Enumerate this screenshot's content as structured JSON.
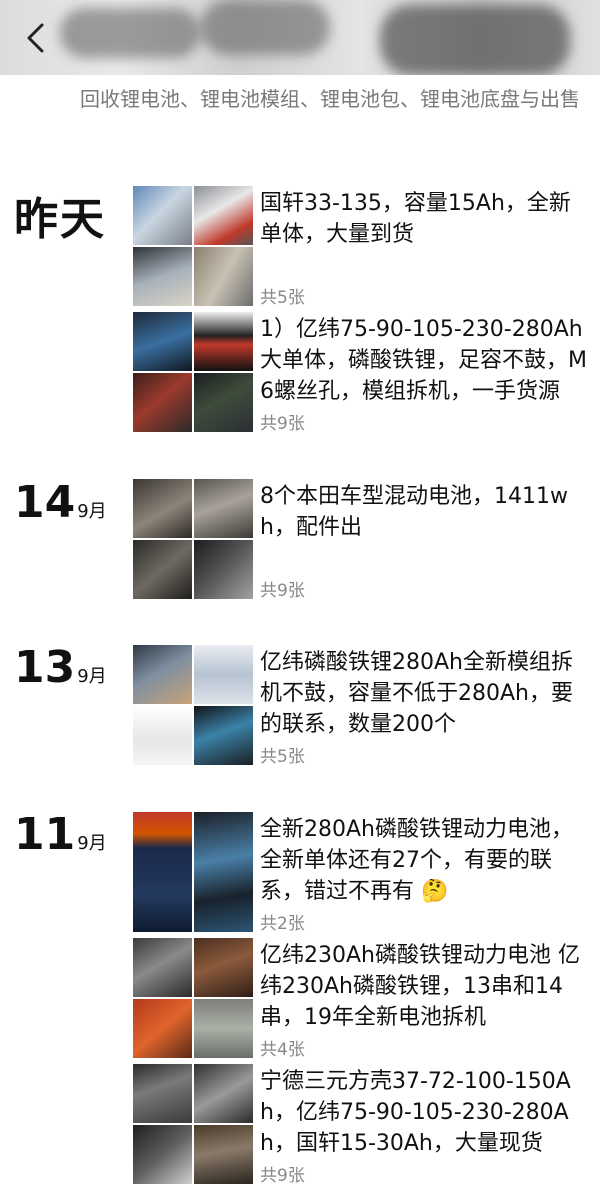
{
  "header": {
    "signature": "回收锂电池、锂电池模组、锂电池包、锂电池底盘与出售"
  },
  "days": [
    {
      "label": "昨天"
    },
    {
      "num": "14",
      "month": "9月"
    },
    {
      "num": "13",
      "month": "9月"
    },
    {
      "num": "11",
      "month": "9月"
    }
  ],
  "posts": [
    {
      "text": "国轩33-135，容量15Ah，全新单体，大量到货",
      "count": "共5张"
    },
    {
      "text": "1）亿纬75-90-105-230-280Ah大单体，磷酸铁锂，足容不鼓，M6螺丝孔，模组拆机，一手货源",
      "count": "共9张"
    },
    {
      "text": "8个本田车型混动电池，1411wh，配件出",
      "count": "共9张"
    },
    {
      "text": "亿纬磷酸铁锂280Ah全新模组拆机不鼓，容量不低于280Ah，要的联系，数量200个",
      "count": "共5张"
    },
    {
      "text": "全新280Ah磷酸铁锂动力电池，全新单体还有27个，有要的联系，错过不再有 🤔",
      "count": "共2张"
    },
    {
      "text": "亿纬230Ah磷酸铁锂动力电池 亿纬230Ah磷酸铁锂，13串和14串，19年全新电池拆机",
      "count": "共4张"
    },
    {
      "text": "宁德三元方壳37-72-100-150Ah，亿纬75-90-105-230-280Ah，国轩15-30Ah，大量现货",
      "count": "共9张"
    }
  ],
  "colors": {
    "text": "#111111",
    "muted": "#888888",
    "signature": "#7a7a7a"
  },
  "icons": {
    "back": "chevron-left-icon"
  }
}
